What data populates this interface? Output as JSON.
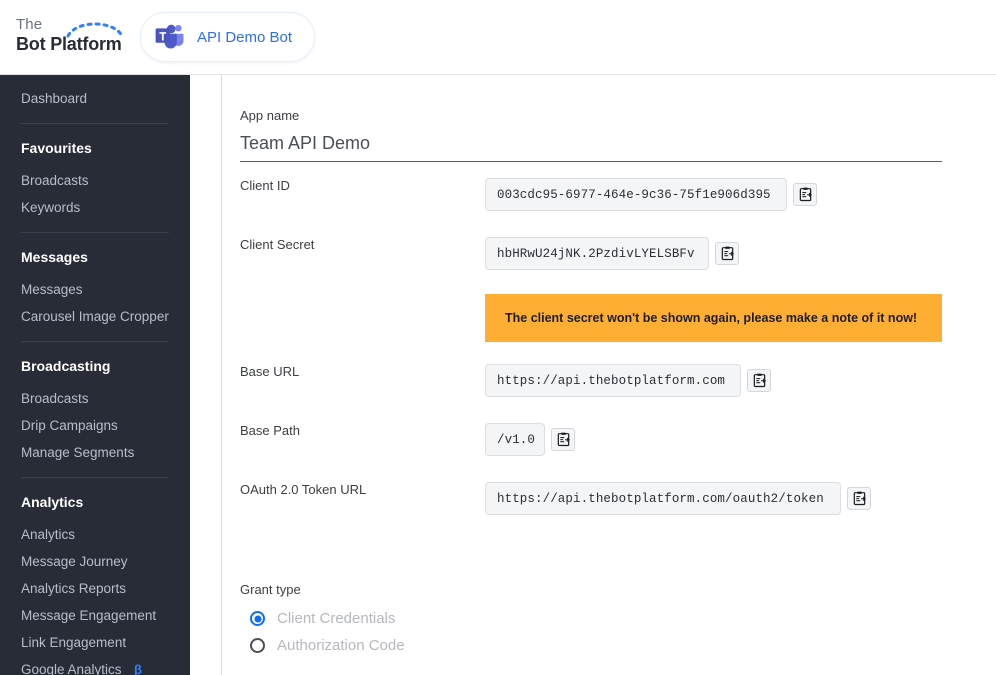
{
  "topbar": {
    "logo": {
      "the": "The",
      "name": "Bot Platform",
      "arc_color": "#2f80ff"
    },
    "bot_pill": {
      "label": "API Demo Bot",
      "icon": "microsoft-teams-icon",
      "label_color": "#2f6fed"
    }
  },
  "sidebar": {
    "background": "#282c37",
    "top_item": {
      "label": "Dashboard"
    },
    "sections": [
      {
        "heading": "Favourites",
        "items": [
          {
            "label": "Broadcasts"
          },
          {
            "label": "Keywords"
          }
        ]
      },
      {
        "heading": "Messages",
        "items": [
          {
            "label": "Messages"
          },
          {
            "label": "Carousel Image Cropper"
          }
        ]
      },
      {
        "heading": "Broadcasting",
        "items": [
          {
            "label": "Broadcasts"
          },
          {
            "label": "Drip Campaigns"
          },
          {
            "label": "Manage Segments"
          }
        ]
      },
      {
        "heading": "Analytics",
        "items": [
          {
            "label": "Analytics"
          },
          {
            "label": "Message Journey"
          },
          {
            "label": "Analytics Reports"
          },
          {
            "label": "Message Engagement"
          },
          {
            "label": "Link Engagement"
          },
          {
            "label": "Google Analytics",
            "badge": "β",
            "badge_color": "#2f80ff"
          }
        ]
      }
    ]
  },
  "main": {
    "app_name": {
      "label": "App name",
      "value": "Team API Demo"
    },
    "fields": [
      {
        "label": "Client ID",
        "value": "003cdc95-6977-464e-9c36-75f1e906d395",
        "copy_label": "copy-icon"
      },
      {
        "label": "Client Secret",
        "value": "hbHRwU24jNK.2PzdivLYELSBFv",
        "copy_label": "copy-icon"
      },
      {
        "label": "Base URL",
        "value": "https://api.thebotplatform.com",
        "copy_label": "copy-icon"
      },
      {
        "label": "Base Path",
        "value": "/v1.0",
        "copy_label": "copy-icon"
      },
      {
        "label": "OAuth 2.0 Token URL",
        "value": "https://api.thebotplatform.com/oauth2/token",
        "copy_label": "copy-icon"
      }
    ],
    "warning": {
      "text": "The client secret won't be shown again, please make a note of it now!",
      "background": "#ffae34"
    },
    "grant_type": {
      "label": "Grant type",
      "options": [
        {
          "label": "Client Credentials",
          "selected": true
        },
        {
          "label": "Authorization Code",
          "selected": false
        }
      ],
      "accent": "#0b6cff"
    }
  }
}
